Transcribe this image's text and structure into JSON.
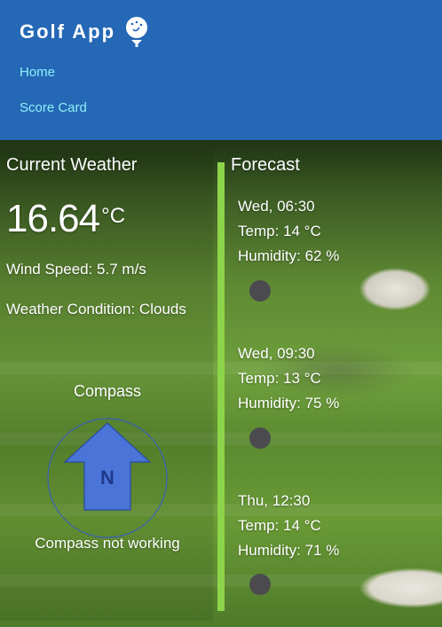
{
  "header": {
    "title": "Golf App",
    "nav": [
      {
        "label": "Home"
      },
      {
        "label": "Score Card"
      }
    ]
  },
  "current": {
    "title": "Current Weather",
    "temperature": "16.64",
    "unit": "°C",
    "wind": "Wind Speed: 5.7 m/s",
    "condition": "Weather Condition: Clouds"
  },
  "compass": {
    "title": "Compass",
    "direction": "N",
    "message": "Compass not working"
  },
  "forecast": {
    "title": "Forecast",
    "items": [
      {
        "time": "Wed, 06:30",
        "temp": "Temp: 14 °C",
        "humidity": "Humidity: 62 %",
        "icon": "weather-icon"
      },
      {
        "time": "Wed, 09:30",
        "temp": "Temp: 13 °C",
        "humidity": "Humidity: 75 %",
        "icon": "weather-icon"
      },
      {
        "time": "Thu, 12:30",
        "temp": "Temp: 14 °C",
        "humidity": "Humidity: 71 %",
        "icon": "weather-icon"
      }
    ]
  },
  "colors": {
    "header_bg": "#2468b6",
    "nav_link": "#8ff0f8",
    "divider": "#8cd44a",
    "compass_arrow": "#3f6fd6"
  }
}
